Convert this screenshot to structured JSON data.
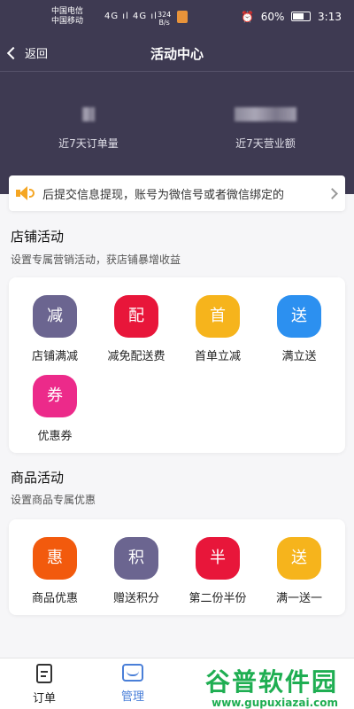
{
  "status_bar": {
    "carrier1": "中国电信",
    "carrier2": "中国移动",
    "signal": "4G ıl 4G ıl",
    "speed": "324",
    "speed_unit": "B/s",
    "battery": "60%",
    "time": "3:13"
  },
  "nav": {
    "back_label": "返回",
    "title": "活动中心"
  },
  "stats": {
    "left_label": "近7天订单量",
    "right_label": "近7天营业额"
  },
  "notice": {
    "text": "后提交信息提现，账号为微信号或者微信绑定的"
  },
  "shop_section": {
    "title": "店铺活动",
    "subtitle": "设置专属营销活动，获店铺暴增收益",
    "items": [
      {
        "glyph": "减",
        "label": "店铺满减",
        "color": "#6b6590"
      },
      {
        "glyph": "配",
        "label": "减免配送费",
        "color": "#e8163a"
      },
      {
        "glyph": "首",
        "label": "首单立减",
        "color": "#f6b41c"
      },
      {
        "glyph": "送",
        "label": "满立送",
        "color": "#2c90f0"
      },
      {
        "glyph": "券",
        "label": "优惠券",
        "color": "#ec2a8a"
      }
    ]
  },
  "goods_section": {
    "title": "商品活动",
    "subtitle": "设置商品专属优惠",
    "items": [
      {
        "glyph": "惠",
        "label": "商品优惠",
        "color": "#f25a0d"
      },
      {
        "glyph": "积",
        "label": "赠送积分",
        "color": "#6b6590"
      },
      {
        "glyph": "半",
        "label": "第二份半份",
        "color": "#e8163a"
      },
      {
        "glyph": "送",
        "label": "满一送一",
        "color": "#f6b41c"
      }
    ]
  },
  "tabbar": {
    "tabs": [
      {
        "label": "订单",
        "color": "#222222"
      },
      {
        "label": "管理",
        "color": "#4a7fd8"
      }
    ]
  },
  "watermark": {
    "main": "谷普软件园",
    "url": "www.gupuxiazai.com"
  }
}
